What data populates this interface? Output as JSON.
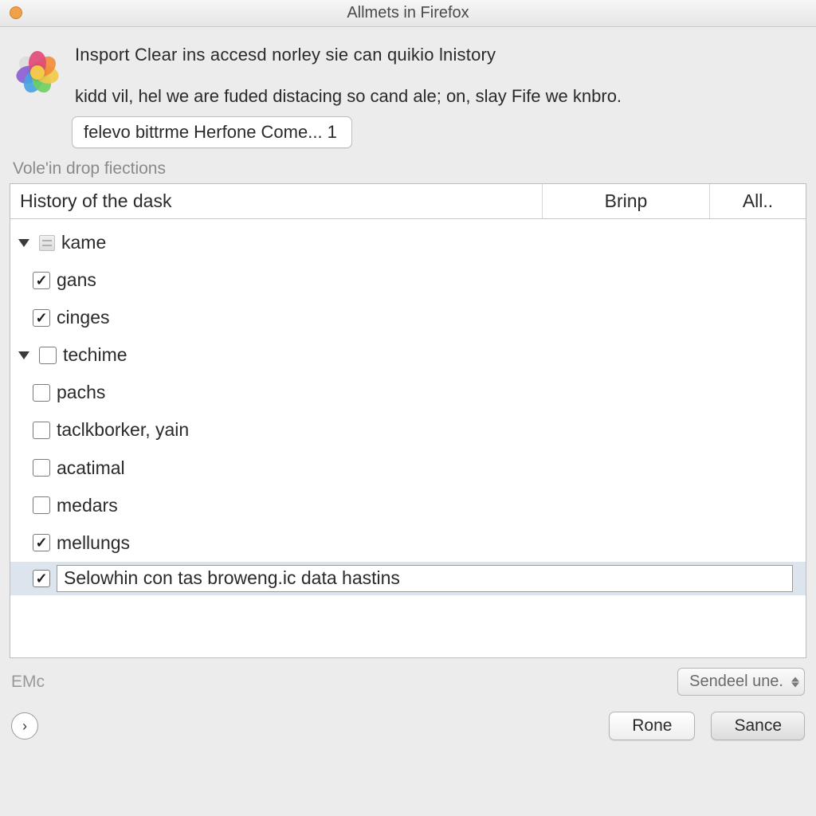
{
  "window": {
    "title": "Allmets in Firefox"
  },
  "intro": {
    "line1": "Insport Clear ins accesd norley sie can quikio lnistory",
    "line2": "kidd vil, hel we are fuded distacing so cand ale; on, slay Fife we knbro.",
    "dropdown_label": "felevo bittrme Herfone Come... 1"
  },
  "section_label": "Vole'in drop fiections",
  "columns": {
    "c1": "History of the dask",
    "c2": "Brinp",
    "c3": "All.."
  },
  "rows": {
    "r0": {
      "label": "kame"
    },
    "r1": {
      "label": "gans"
    },
    "r2": {
      "label": "cinges"
    },
    "r3": {
      "label": "techime"
    },
    "r4": {
      "label": "pachs"
    },
    "r5": {
      "label": "taclkborker, yain"
    },
    "r6": {
      "label": "acatimal"
    },
    "r7": {
      "label": "medars"
    },
    "r8": {
      "label": "mellungs"
    },
    "r9": {
      "label": "Selowhin con tas broweng.ic data hastins"
    }
  },
  "footer": {
    "emc": "EMc",
    "combo_label": "Sendeel une.",
    "button_rone": "Rone",
    "button_sance": "Sance"
  },
  "petal_colors": [
    "#e24b7a",
    "#f28c3b",
    "#f2c94c",
    "#6fcf5f",
    "#4aa3e2",
    "#8a5fd1",
    "#dcdcdc"
  ]
}
